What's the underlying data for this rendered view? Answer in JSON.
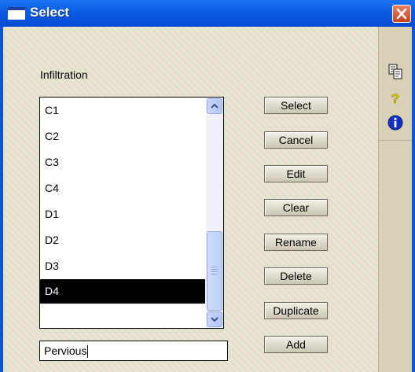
{
  "window": {
    "title": "Select"
  },
  "list": {
    "label": "Infiltration",
    "items": [
      "C1",
      "C2",
      "C3",
      "C4",
      "D1",
      "D2",
      "D3",
      "D4"
    ],
    "selected": "D4"
  },
  "buttons": {
    "select": "Select",
    "cancel": "Cancel",
    "edit": "Edit",
    "clear": "Clear",
    "rename": "Rename",
    "delete": "Delete",
    "duplicate": "Duplicate",
    "add": "Add"
  },
  "name_input": {
    "value": "Pervious"
  },
  "sidebar": {
    "icons": [
      "copy-icon",
      "help-icon",
      "info-icon"
    ]
  },
  "colors": {
    "titlebar": "#0a5ce6",
    "client": "#e7e2cf",
    "selection": "#000000"
  }
}
